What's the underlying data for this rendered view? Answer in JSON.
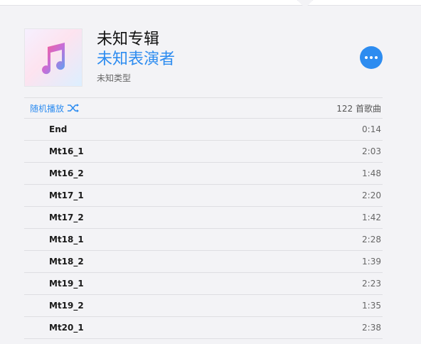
{
  "album": {
    "title": "未知专辑",
    "artist": "未知表演者",
    "genre": "未知类型",
    "artwork_icon": "music-note-icon",
    "more_icon": "more-ellipsis-icon"
  },
  "toolbar": {
    "shuffle_label": "随机播放",
    "shuffle_icon": "shuffle-icon",
    "song_count": "122 首歌曲"
  },
  "colors": {
    "accent": "#2d8cf0",
    "background": "#f3f3f6"
  },
  "tracks": [
    {
      "name": "End",
      "duration": "0:14"
    },
    {
      "name": "Mt16_1",
      "duration": "2:03"
    },
    {
      "name": "Mt16_2",
      "duration": "1:48"
    },
    {
      "name": "Mt17_1",
      "duration": "2:20"
    },
    {
      "name": "Mt17_2",
      "duration": "1:42"
    },
    {
      "name": "Mt18_1",
      "duration": "2:28"
    },
    {
      "name": "Mt18_2",
      "duration": "1:39"
    },
    {
      "name": "Mt19_1",
      "duration": "2:23"
    },
    {
      "name": "Mt19_2",
      "duration": "1:35"
    },
    {
      "name": "Mt20_1",
      "duration": "2:38"
    }
  ]
}
